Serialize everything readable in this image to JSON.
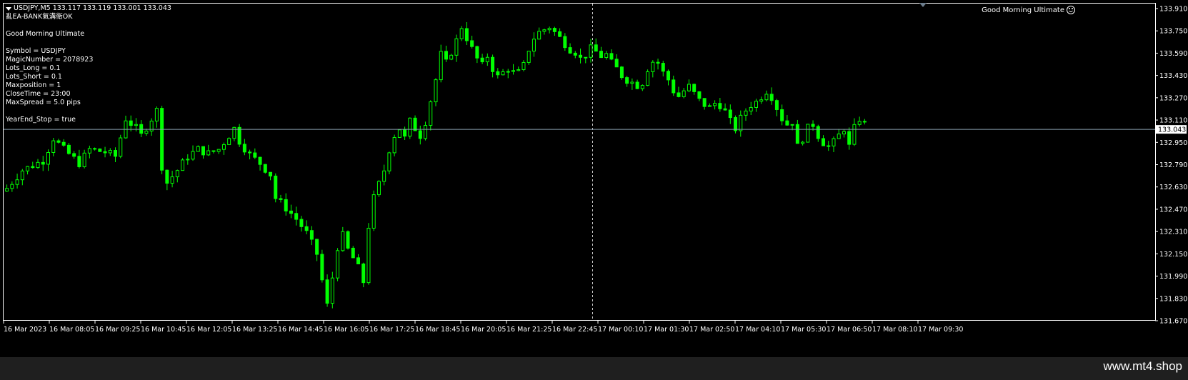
{
  "header": {
    "symbol_line": "USDJPY,M5  133.117 133.119 133.001 133.043",
    "ea_status": "亂EA-BANK氣溝衛OK"
  },
  "info_panel": [
    "",
    "Good Morning Ultimate",
    "",
    "Symbol = USDJPY",
    "MagicNumber = 2078923",
    "Lots_Long = 0.1",
    "Lots_Short = 0.1",
    "Maxposition = 1",
    "CloseTime = 23:00",
    "MaxSpread = 5.0 pips",
    "",
    "YearEnd_Stop = true"
  ],
  "ea_label": "Good Morning Ultimate",
  "price_axis": {
    "labels": [
      "133.910",
      "133.750",
      "133.590",
      "133.430",
      "133.270",
      "133.110",
      "132.950",
      "132.790",
      "132.630",
      "132.470",
      "132.310",
      "132.150",
      "131.990",
      "131.830",
      "131.670"
    ],
    "current_price": "133.043"
  },
  "time_axis": {
    "labels": [
      "16 Mar 2023",
      "16 Mar 08:05",
      "16 Mar 09:25",
      "16 Mar 10:45",
      "16 Mar 12:05",
      "16 Mar 13:25",
      "16 Mar 14:45",
      "16 Mar 16:05",
      "16 Mar 17:25",
      "16 Mar 18:45",
      "16 Mar 20:05",
      "16 Mar 21:25",
      "16 Mar 22:45",
      "17 Mar 00:10",
      "17 Mar 01:30",
      "17 Mar 02:50",
      "17 Mar 04:10",
      "17 Mar 05:30",
      "17 Mar 06:50",
      "17 Mar 08:10",
      "17 Mar 09:30"
    ]
  },
  "watermark": "www.mt4.shop",
  "colors": {
    "background": "#000000",
    "candle": "#00ff00",
    "grid_text": "#ffffff",
    "price_line": "#8aa0b0",
    "crosshair": "#cccccc"
  },
  "chart_data": {
    "type": "candlestick",
    "symbol": "USDJPY",
    "timeframe": "M5",
    "ylim": [
      131.67,
      133.95
    ],
    "current_price": 133.043,
    "close_path": [
      [
        0,
        132.62
      ],
      [
        3,
        132.75
      ],
      [
        7,
        132.82
      ],
      [
        9,
        132.98
      ],
      [
        11,
        132.9
      ],
      [
        14,
        132.8
      ],
      [
        16,
        132.9
      ],
      [
        19,
        132.88
      ],
      [
        21,
        132.85
      ],
      [
        23,
        133.12
      ],
      [
        25,
        133.05
      ],
      [
        26,
        133.0
      ],
      [
        29,
        133.18
      ],
      [
        30,
        132.78
      ],
      [
        31,
        132.66
      ],
      [
        33,
        132.75
      ],
      [
        35,
        132.85
      ],
      [
        37,
        132.9
      ],
      [
        39,
        132.87
      ],
      [
        41,
        132.9
      ],
      [
        43,
        133.0
      ],
      [
        44,
        133.05
      ],
      [
        45,
        132.96
      ],
      [
        47,
        132.86
      ],
      [
        49,
        132.8
      ],
      [
        51,
        132.72
      ],
      [
        52,
        132.55
      ],
      [
        54,
        132.48
      ],
      [
        56,
        132.4
      ],
      [
        58,
        132.3
      ],
      [
        60,
        132.15
      ],
      [
        61,
        131.96
      ],
      [
        62,
        131.78
      ],
      [
        63,
        131.98
      ],
      [
        64,
        132.2
      ],
      [
        65,
        132.28
      ],
      [
        66,
        132.18
      ],
      [
        67,
        132.12
      ],
      [
        68,
        132.05
      ],
      [
        69,
        131.95
      ],
      [
        70,
        132.35
      ],
      [
        71,
        132.55
      ],
      [
        72,
        132.65
      ],
      [
        73,
        132.75
      ],
      [
        74,
        132.9
      ],
      [
        75,
        133.0
      ],
      [
        76,
        133.05
      ],
      [
        77,
        132.98
      ],
      [
        78,
        133.1
      ],
      [
        79,
        133.05
      ],
      [
        80,
        133.0
      ],
      [
        81,
        133.1
      ],
      [
        82,
        133.25
      ],
      [
        83,
        133.4
      ],
      [
        84,
        133.58
      ],
      [
        85,
        133.52
      ],
      [
        86,
        133.6
      ],
      [
        87,
        133.68
      ],
      [
        88,
        133.78
      ],
      [
        89,
        133.7
      ],
      [
        90,
        133.62
      ],
      [
        91,
        133.55
      ],
      [
        92,
        133.5
      ],
      [
        93,
        133.57
      ],
      [
        94,
        133.48
      ],
      [
        95,
        133.42
      ],
      [
        96,
        133.45
      ],
      [
        97,
        133.48
      ],
      [
        98,
        133.45
      ],
      [
        99,
        133.45
      ],
      [
        100,
        133.5
      ],
      [
        101,
        133.62
      ],
      [
        102,
        133.7
      ],
      [
        103,
        133.74
      ],
      [
        104,
        133.76
      ],
      [
        105,
        133.78
      ],
      [
        106,
        133.74
      ],
      [
        107,
        133.7
      ],
      [
        108,
        133.66
      ],
      [
        109,
        133.62
      ],
      [
        110,
        133.6
      ],
      [
        111,
        133.55
      ],
      [
        112,
        133.58
      ],
      [
        113,
        133.62
      ],
      [
        114,
        133.6
      ],
      [
        115,
        133.57
      ],
      [
        116,
        133.58
      ],
      [
        117,
        133.52
      ],
      [
        118,
        133.48
      ],
      [
        119,
        133.43
      ],
      [
        120,
        133.4
      ],
      [
        121,
        133.38
      ],
      [
        122,
        133.36
      ],
      [
        123,
        133.38
      ],
      [
        124,
        133.48
      ],
      [
        125,
        133.53
      ],
      [
        126,
        133.52
      ],
      [
        127,
        133.45
      ],
      [
        128,
        133.4
      ],
      [
        129,
        133.32
      ],
      [
        130,
        133.28
      ],
      [
        131,
        133.32
      ],
      [
        132,
        133.35
      ],
      [
        133,
        133.3
      ],
      [
        134,
        133.25
      ],
      [
        135,
        133.22
      ],
      [
        136,
        133.2
      ],
      [
        137,
        133.23
      ],
      [
        138,
        133.22
      ],
      [
        139,
        133.17
      ],
      [
        140,
        133.1
      ],
      [
        141,
        133.05
      ],
      [
        142,
        133.12
      ],
      [
        143,
        133.18
      ],
      [
        144,
        133.22
      ],
      [
        145,
        133.24
      ],
      [
        146,
        133.28
      ],
      [
        147,
        133.32
      ],
      [
        148,
        133.28
      ],
      [
        149,
        133.2
      ],
      [
        150,
        133.12
      ],
      [
        151,
        133.08
      ],
      [
        152,
        133.1
      ],
      [
        153,
        132.92
      ],
      [
        154,
        132.98
      ],
      [
        155,
        133.05
      ],
      [
        156,
        133.08
      ],
      [
        157,
        133.0
      ],
      [
        158,
        132.95
      ],
      [
        159,
        132.92
      ],
      [
        160,
        132.95
      ],
      [
        161,
        133.0
      ],
      [
        162,
        133.05
      ],
      [
        163,
        132.92
      ],
      [
        164,
        133.05
      ],
      [
        165,
        133.12
      ],
      [
        166,
        133.08
      ]
    ],
    "notes": "167 M5 candles; close_path lists [bar_index, approx close price] read from the chart; bars between listed points are interpolated."
  }
}
